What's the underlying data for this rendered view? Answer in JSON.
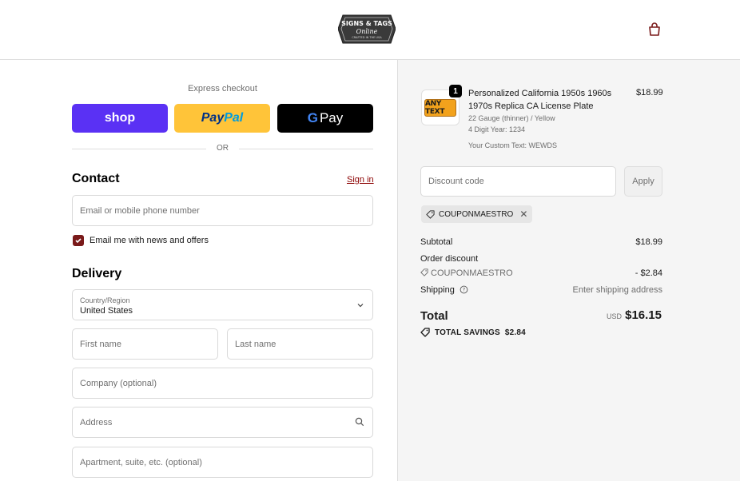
{
  "header": {
    "logo_line1": "SIGNS & TAGS",
    "logo_line2": "Online",
    "logo_line3": "CRAFTED IN THE USA",
    "cart_icon": "shopping-bag-icon"
  },
  "express": {
    "title": "Express checkout",
    "shop_label": "shop",
    "paypal_label_1": "Pay",
    "paypal_label_2": "Pal",
    "gpay_label_g": "G",
    "gpay_label": "Pay",
    "or_label": "OR"
  },
  "contact": {
    "title": "Contact",
    "signin_label": "Sign in",
    "email_placeholder": "Email or mobile phone number",
    "newsletter_label": "Email me with news and offers",
    "newsletter_checked": true
  },
  "delivery": {
    "title": "Delivery",
    "country_label": "Country/Region",
    "country_value": "United States",
    "first_name_placeholder": "First name",
    "last_name_placeholder": "Last name",
    "company_placeholder": "Company (optional)",
    "address_placeholder": "Address",
    "apartment_placeholder": "Apartment, suite, etc. (optional)"
  },
  "order": {
    "product": {
      "quantity": "1",
      "name": "Personalized California 1950s 1960s 1970s Replica CA License Plate",
      "price": "$18.99",
      "variant": "22 Gauge (thinner) / Yellow",
      "digit_year": "4 Digit Year: 1234",
      "custom_text": "Your Custom Text: WEWDS",
      "thumb_text": "ANY TEXT"
    },
    "discount_placeholder": "Discount code",
    "apply_label": "Apply",
    "applied_coupon": "COUPONMAESTRO",
    "subtotal_label": "Subtotal",
    "subtotal_value": "$18.99",
    "order_discount_label": "Order discount",
    "discount_code": "COUPONMAESTRO",
    "discount_value": "- $2.84",
    "shipping_label": "Shipping",
    "shipping_value": "Enter shipping address",
    "total_label": "Total",
    "total_currency": "USD",
    "total_value": "$16.15",
    "savings_label": "TOTAL SAVINGS",
    "savings_value": "$2.84"
  },
  "colors": {
    "shop_purple": "#5a31f4",
    "paypal_yellow": "#ffc439",
    "gpay_black": "#000000",
    "accent_maroon": "#7a1a1a"
  }
}
